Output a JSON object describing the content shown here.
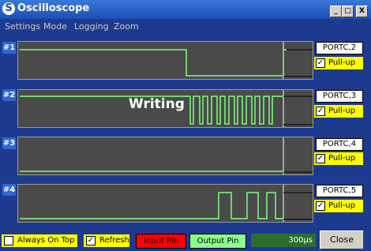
{
  "window": {
    "title": "Oscilloscope",
    "icon": "S"
  },
  "titlebar_buttons": {
    "minimize": "_",
    "maximize": "□",
    "close": "X"
  },
  "menu": [
    "Settings",
    "Mode",
    "Logging",
    "Zoom"
  ],
  "channels": [
    {
      "label": "#1",
      "port": "PORTC,2",
      "pull": "Pull-up"
    },
    {
      "label": "#2",
      "port": "PORTC,3",
      "pull": "Pull-up",
      "overlay": "Writing"
    },
    {
      "label": "#3",
      "port": "PORTC,4",
      "pull": "Pull-up"
    },
    {
      "label": "#4",
      "port": "PORTC,5",
      "pull": "Pull-up"
    }
  ],
  "bottom": {
    "always_on_top": "Always On Top",
    "refresh": "Refresh",
    "input_pin": "Input Pin",
    "output_pin": "Output Pin",
    "timebase": "300µs",
    "close": "Close"
  },
  "colors": {
    "trace": "#7cff7c",
    "input_pin": "#ff0000",
    "output_pin": "#8cff8c",
    "panel": "#1e3a8e"
  }
}
